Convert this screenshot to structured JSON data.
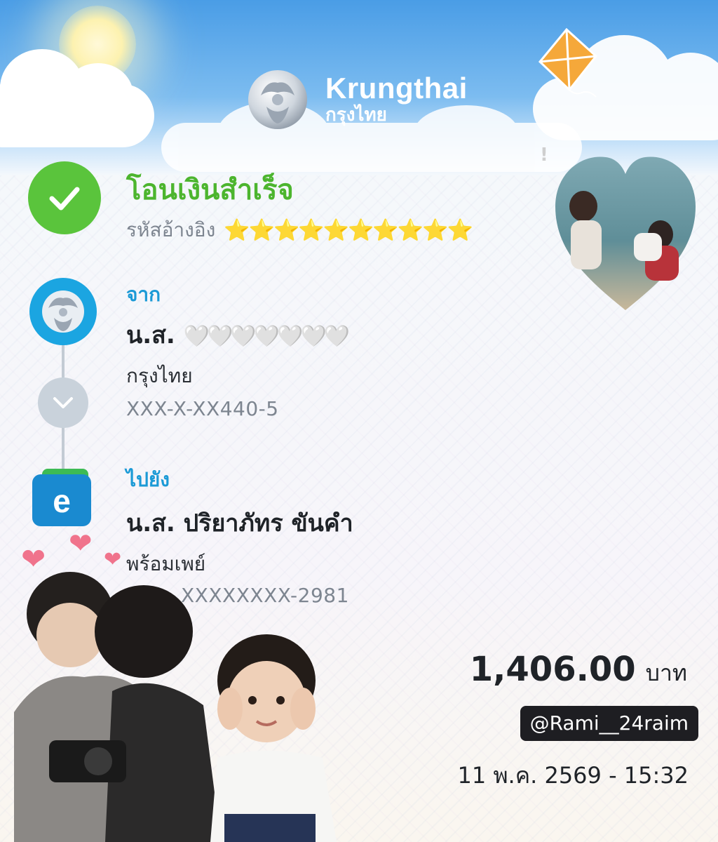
{
  "header": {
    "brand_en": "Krungthai",
    "brand_th": "กรุงไทย"
  },
  "status": {
    "title": "โอนเงินสำเร็จ",
    "reference_label": "รหัสอ้างอิง",
    "reference_mask": "⭐⭐⭐⭐⭐⭐⭐⭐⭐⭐"
  },
  "from": {
    "label": "จาก",
    "name_prefix": "น.ส.",
    "name_mask": "🤍🤍🤍🤍🤍🤍🤍",
    "bank": "กรุงไทย",
    "account": "XXX-X-XX440-5"
  },
  "to": {
    "label": "ไปยัง",
    "name": "น.ส. ปริยาภัทร ขันคำ",
    "bank": "พร้อมเพย์",
    "account": "XXXXXXXX-2981"
  },
  "amount": {
    "value": "1,406.00",
    "unit": "บาท"
  },
  "watermark": "@Rami__24raim",
  "datetime": "11 พ.ค. 2569 - 15:32",
  "colors": {
    "success_green": "#5ac43c",
    "label_blue": "#1b9ad6",
    "sky_blue": "#4a9de6"
  },
  "icons": [
    "check-icon",
    "bank-avatar-icon",
    "chevron-down-icon",
    "e-wallet-icon",
    "kite-icon",
    "sun-icon"
  ]
}
